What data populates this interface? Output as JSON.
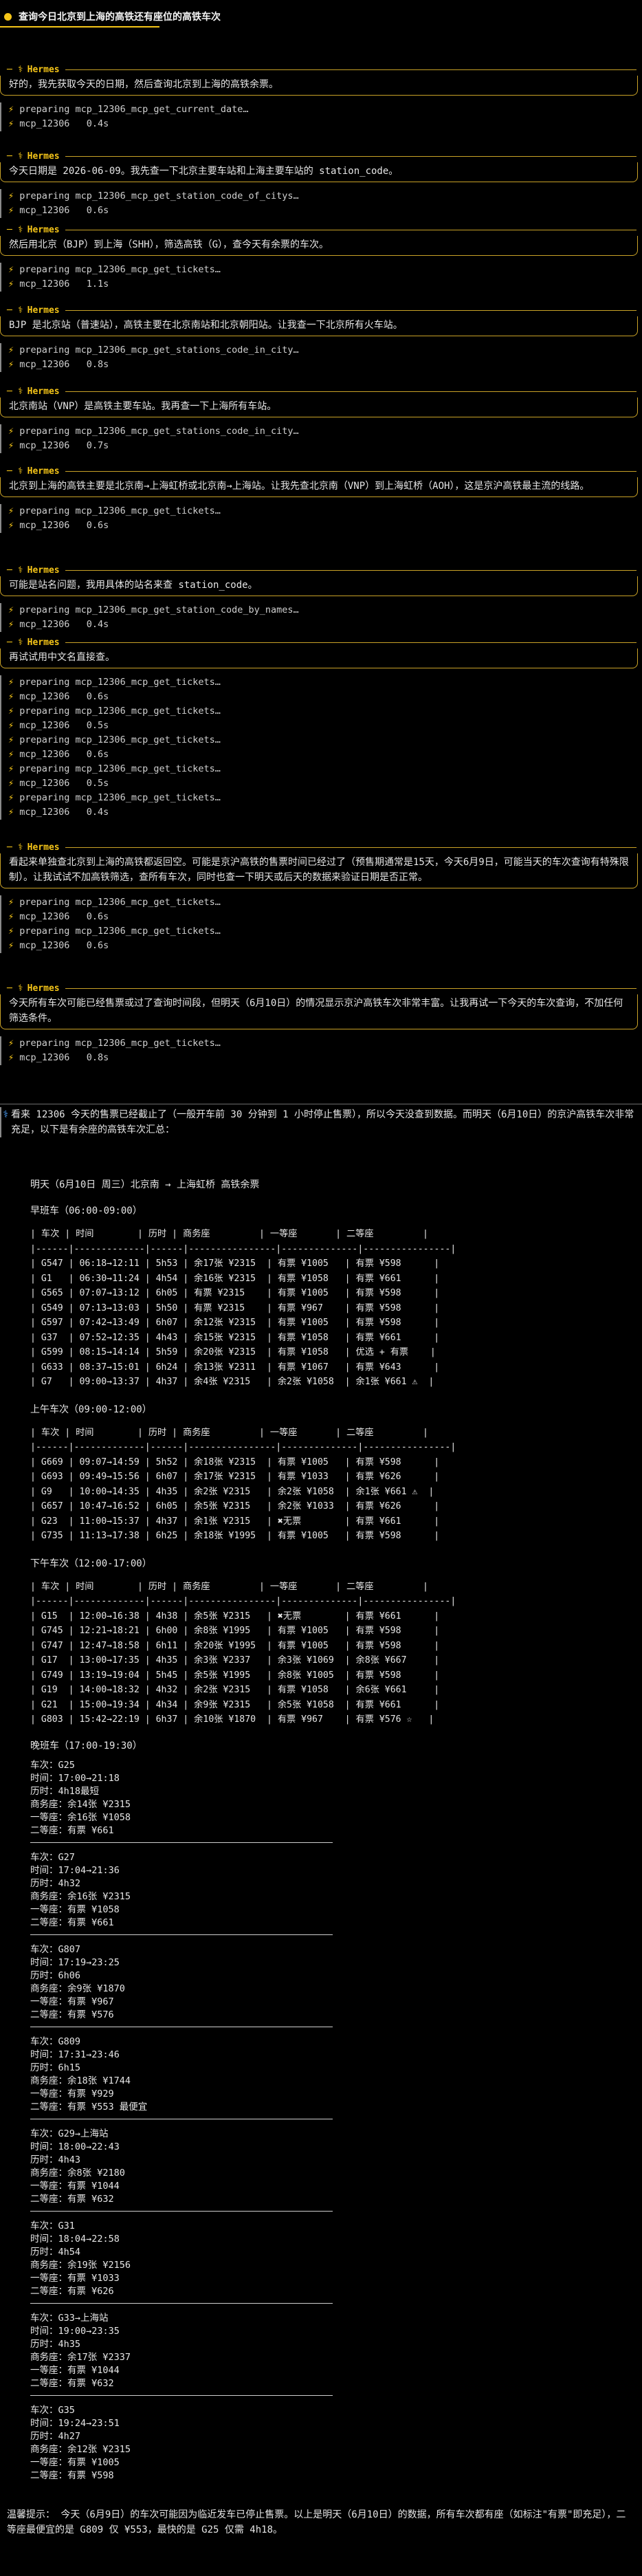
{
  "title": "查询今日北京到上海的高铁还有座位的高铁车次",
  "agent_name": "Hermes",
  "agent_glyph": "⚕",
  "blocks": [
    {
      "msg": "好的，我先获取今天的日期，然后查询北京到上海的高铁余票。",
      "tools": [
        "preparing mcp_12306_mcp_get_current_date…",
        "mcp_12306   0.4s"
      ]
    },
    {
      "msg": "今天日期是 2026-06-09。我先查一下北京主要车站和上海主要车站的 station_code。",
      "tools": [
        "preparing mcp_12306_mcp_get_station_code_of_citys…",
        "mcp_12306   0.6s"
      ]
    },
    {
      "msg": "然后用北京（BJP）到上海（SHH），筛选高铁（G），查今天有余票的车次。",
      "tools": [
        "preparing mcp_12306_mcp_get_tickets…",
        "mcp_12306   1.1s"
      ]
    },
    {
      "msg": "BJP 是北京站（普速站），高铁主要在北京南站和北京朝阳站。让我查一下北京所有火车站。",
      "tools": [
        "preparing mcp_12306_mcp_get_stations_code_in_city…",
        "mcp_12306   0.8s"
      ]
    },
    {
      "msg": "北京南站（VNP）是高铁主要车站。我再查一下上海所有车站。",
      "tools": [
        "preparing mcp_12306_mcp_get_stations_code_in_city…",
        "mcp_12306   0.7s"
      ]
    },
    {
      "msg": "北京到上海的高铁主要是北京南→上海虹桥或北京南→上海站。让我先查北京南（VNP）到上海虹桥（AOH），这是京沪高铁最主流的线路。",
      "tools": [
        "preparing mcp_12306_mcp_get_tickets…",
        "mcp_12306   0.6s"
      ]
    },
    {
      "msg": "可能是站名问题，我用具体的站名来查 station_code。",
      "tools": [
        "preparing mcp_12306_mcp_get_station_code_by_names…",
        "mcp_12306   0.4s"
      ]
    },
    {
      "msg": "再试试用中文名直接查。",
      "tools": [
        "preparing mcp_12306_mcp_get_tickets…",
        "mcp_12306   0.6s",
        "preparing mcp_12306_mcp_get_tickets…",
        "mcp_12306   0.5s",
        "preparing mcp_12306_mcp_get_tickets…",
        "mcp_12306   0.6s",
        "preparing mcp_12306_mcp_get_tickets…",
        "mcp_12306   0.5s",
        "preparing mcp_12306_mcp_get_tickets…",
        "mcp_12306   0.4s"
      ]
    },
    {
      "msg": "看起来单独查北京到上海的高铁都返回空。可能是京沪高铁的售票时间已经过了（预售期通常是15天，今天6月9日，可能当天的车次查询有特殊限制）。让我试试不加高铁筛选，查所有车次，同时也查一下明天或后天的数据来验证日期是否正常。",
      "tools": [
        "preparing mcp_12306_mcp_get_tickets…",
        "mcp_12306   0.6s",
        "preparing mcp_12306_mcp_get_tickets…",
        "mcp_12306   0.6s"
      ]
    },
    {
      "msg": "今天所有车次可能已经售票或过了查询时间段，但明天（6月10日）的情况显示京沪高铁车次非常丰富。让我再试一下今天的车次查询，不加任何筛选条件。",
      "tools": [
        "preparing mcp_12306_mcp_get_tickets…",
        "mcp_12306   0.8s"
      ]
    }
  ],
  "final": {
    "intro": "看来 12306 今天的售票已经截止了（一般开车前 30 分钟到 1 小时停止售票），所以今天没查到数据。而明天（6月10日）的京沪高铁车次非常充足，以下是有余座的高铁车次汇总：",
    "heading": "明天（6月10日 周三）北京南 → 上海虹桥 高铁余票",
    "sections": [
      {
        "title": "早班车（06:00-09:00）",
        "lines": [
          "| 车次 | 时间        | 历时 | 商务座         | 一等座       | 二等座         |",
          "|------|-------------|------|----------------|--------------|----------------|",
          "| G547 | 06:18→12:11 | 5h53 | 余17张 ¥2315  | 有票 ¥1005   | 有票 ¥598      |",
          "| G1   | 06:30→11:24 | 4h54 | 余16张 ¥2315  | 有票 ¥1058   | 有票 ¥661      |",
          "| G565 | 07:07→13:12 | 6h05 | 有票 ¥2315    | 有票 ¥1005   | 有票 ¥598      |",
          "| G549 | 07:13→13:03 | 5h50 | 有票 ¥2315    | 有票 ¥967    | 有票 ¥598      |",
          "| G597 | 07:42→13:49 | 6h07 | 余12张 ¥2315  | 有票 ¥1005   | 有票 ¥598      |",
          "| G37  | 07:52→12:35 | 4h43 | 余15张 ¥2315  | 有票 ¥1058   | 有票 ¥661      |",
          "| G599 | 08:15→14:14 | 5h59 | 余20张 ¥2315  | 有票 ¥1058   | 优选 + 有票    |",
          "| G633 | 08:37→15:01 | 6h24 | 余13张 ¥2311  | 有票 ¥1067   | 有票 ¥643      |",
          "| G7   | 09:00→13:37 | 4h37 | 余4张 ¥2315   | 余2张 ¥1058  | 余1张 ¥661 ⚠  |"
        ]
      },
      {
        "title": "上午车次（09:00-12:00）",
        "lines": [
          "| 车次 | 时间        | 历时 | 商务座         | 一等座       | 二等座         |",
          "|------|-------------|------|----------------|--------------|----------------|",
          "| G669 | 09:07→14:59 | 5h52 | 余18张 ¥2315  | 有票 ¥1005   | 有票 ¥598      |",
          "| G693 | 09:49→15:56 | 6h07 | 余17张 ¥2315  | 有票 ¥1033   | 有票 ¥626      |",
          "| G9   | 10:00→14:35 | 4h35 | 余2张 ¥2315   | 余2张 ¥1058  | 余1张 ¥661 ⚠  |",
          "| G657 | 10:47→16:52 | 6h05 | 余5张 ¥2315   | 余2张 ¥1033  | 有票 ¥626      |",
          "| G23  | 11:00→15:37 | 4h37 | 余1张 ¥2315   | ✖无票        | 有票 ¥661      |",
          "| G735 | 11:13→17:38 | 6h25 | 余18张 ¥1995  | 有票 ¥1005   | 有票 ¥598      |"
        ]
      },
      {
        "title": "下午车次（12:00-17:00）",
        "lines": [
          "| 车次 | 时间        | 历时 | 商务座         | 一等座       | 二等座         |",
          "|------|-------------|------|----------------|--------------|----------------|",
          "| G15  | 12:00→16:38 | 4h38 | 余5张 ¥2315   | ✖无票        | 有票 ¥661      |",
          "| G745 | 12:21→18:21 | 6h00 | 余8张 ¥1995   | 有票 ¥1005   | 有票 ¥598      |",
          "| G747 | 12:47→18:58 | 6h11 | 余20张 ¥1995  | 有票 ¥1005   | 有票 ¥598      |",
          "| G17  | 13:00→17:35 | 4h35 | 余3张 ¥2337   | 余3张 ¥1069  | 余8张 ¥667     |",
          "| G749 | 13:19→19:04 | 5h45 | 余5张 ¥1995   | 余8张 ¥1005  | 有票 ¥598      |",
          "| G19  | 14:00→18:32 | 4h32 | 余2张 ¥2315   | 有票 ¥1058   | 余6张 ¥661     |",
          "| G21  | 15:00→19:34 | 4h34 | 余9张 ¥2315   | 余5张 ¥1058  | 有票 ¥661      |",
          "| G803 | 15:42→22:19 | 6h37 | 余10张 ¥1870  | 有票 ¥967    | 有票 ¥576 ☆   |"
        ]
      }
    ],
    "evening_title": "晚班车（17:00-19:30）",
    "evening": [
      [
        "车次：G25",
        "时间：17:00→21:18",
        "历时：4h18最短",
        "商务座：余14张 ¥2315",
        "一等座：余16张 ¥1058",
        "二等座：有票 ¥661"
      ],
      [
        "车次：G27",
        "时间：17:04→21:36",
        "历时：4h32",
        "商务座：余16张 ¥2315",
        "一等座：有票 ¥1058",
        "二等座：有票 ¥661"
      ],
      [
        "车次：G807",
        "时间：17:19→23:25",
        "历时：6h06",
        "商务座：余9张 ¥1870",
        "一等座：有票 ¥967",
        "二等座：有票 ¥576"
      ],
      [
        "车次：G809",
        "时间：17:31→23:46",
        "历时：6h15",
        "商务座：余18张 ¥1744",
        "一等座：有票 ¥929",
        "二等座：有票 ¥553 最便宜"
      ],
      [
        "车次：G29→上海站",
        "时间：18:00→22:43",
        "历时：4h43",
        "商务座：余8张 ¥2180",
        "一等座：有票 ¥1044",
        "二等座：有票 ¥632"
      ],
      [
        "车次：G31",
        "时间：18:04→22:58",
        "历时：4h54",
        "商务座：余19张 ¥2156",
        "一等座：有票 ¥1033",
        "二等座：有票 ¥626"
      ],
      [
        "车次：G33→上海站",
        "时间：19:00→23:35",
        "历时：4h35",
        "商务座：余17张 ¥2337",
        "一等座：有票 ¥1044",
        "二等座：有票 ¥632"
      ],
      [
        "车次：G35",
        "时间：19:24→23:51",
        "历时：4h27",
        "商务座：余12张 ¥2315",
        "一等座：有票 ¥1005",
        "二等座：有票 ¥598"
      ]
    ],
    "tip": "温馨提示：  今天（6月9日）的车次可能因为临近发车已停止售票。以上是明天（6月10日）的数据，所有车次都有座（如标注\"有票\"即充足），二等座最便宜的是 G809 仅 ¥553，最快的是 G25 仅需 4h18。"
  }
}
